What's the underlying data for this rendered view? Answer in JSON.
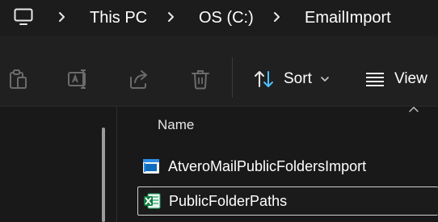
{
  "address_bar": {
    "breadcrumbs": [
      "This PC",
      "OS (C:)",
      "EmailImport"
    ]
  },
  "command_bar": {
    "sort_label": "Sort",
    "view_label": "View"
  },
  "file_list": {
    "column_name": "Name",
    "items": [
      {
        "name": "AtveroMailPublicFoldersImport",
        "icon": "application-icon",
        "selected": false
      },
      {
        "name": "PublicFolderPaths",
        "icon": "excel-file-icon",
        "selected": true
      }
    ]
  },
  "colors": {
    "background": "#191919",
    "commandbar": "#202020",
    "selection_border": "#d0d0d0"
  }
}
